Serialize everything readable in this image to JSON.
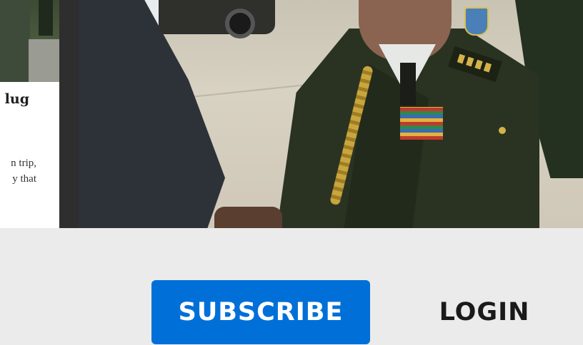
{
  "card": {
    "title": "lug",
    "body_lines": [
      "n trip,",
      "y that"
    ]
  },
  "hero": {
    "image": "handshake-photo"
  },
  "actions": {
    "subscribe_label": "SUBSCRIBE",
    "login_label": "LOGIN"
  },
  "colors": {
    "accent": "#0070d8",
    "background": "#ebebeb",
    "text": "#1a1a1a"
  }
}
